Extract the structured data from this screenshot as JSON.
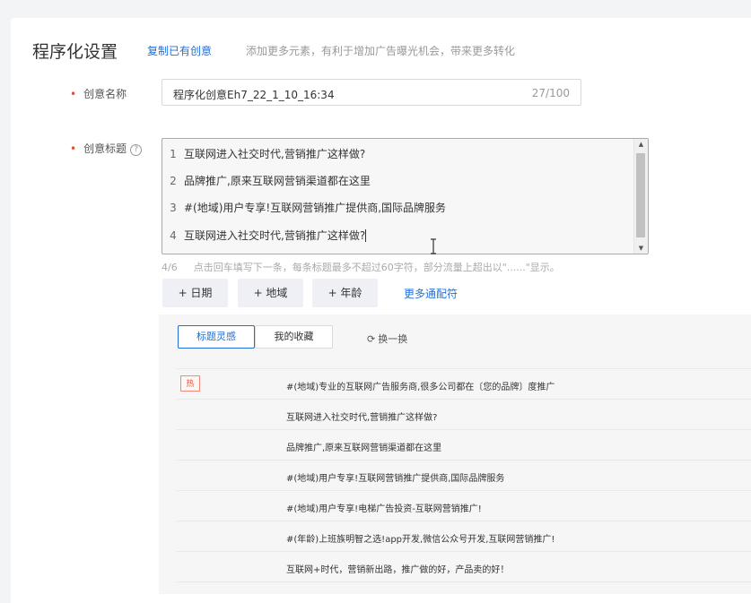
{
  "section": {
    "title": "程序化设置",
    "copy_link": "复制已有创意",
    "hint": "添加更多元素，有利于增加广告曝光机会，带来更多转化"
  },
  "creative_name": {
    "label": "创意名称",
    "value": "程序化创意Eh7_22_1_10_16:34",
    "counter": "27/100"
  },
  "creative_title": {
    "label": "创意标题",
    "help_icon": "question-circle-icon",
    "lines": [
      {
        "no": "1",
        "text": "互联网进入社交时代,营销推广这样做?"
      },
      {
        "no": "2",
        "text": "品牌推广,原来互联网营销渠道都在这里"
      },
      {
        "no": "3",
        "text": "#(地域)用户专享!互联网营销推广提供商,国际品牌服务"
      },
      {
        "no": "4",
        "text": "互联网进入社交时代,营销推广这样做?"
      }
    ],
    "count": "4/6",
    "tip": "点击回车填写下一条，每条标题最多不超过60字符，部分流量上超出以\"......\"显示。"
  },
  "wildcards": {
    "date": "+ 日期",
    "region": "+ 地域",
    "age": "+ 年龄",
    "more": "更多通配符"
  },
  "inspiration": {
    "tabs": [
      "标题灵感",
      "我的收藏"
    ],
    "refresh": "换一换",
    "refresh_icon": "refresh-icon",
    "hot_badge": "热",
    "items": [
      "#(地域)专业的互联网广告服务商,很多公司都在〔您的品牌〕度推广",
      "互联网进入社交时代,营销推广这样做?",
      "品牌推广,原来互联网营销渠道都在这里",
      "#(地域)用户专享!互联网营销推广提供商,国际品牌服务",
      "#(地域)用户专享!电梯广告投资-互联网营销推广!",
      "#(年龄)上班族明智之选!app开发,微信公众号开发,互联网营销推广!",
      "互联网+时代，营销新出路，推广做的好，产品卖的好！"
    ]
  }
}
